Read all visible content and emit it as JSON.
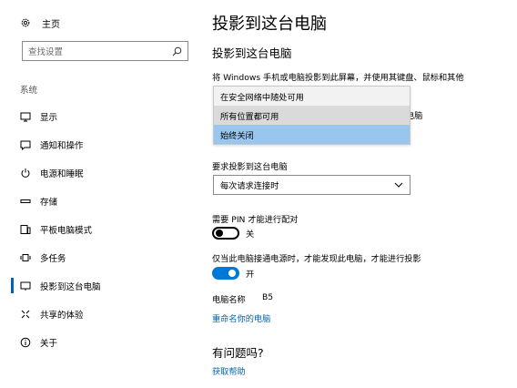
{
  "sidebar": {
    "home_label": "主页",
    "search_placeholder": "查找设置",
    "section_title": "系统",
    "items": [
      {
        "label": "显示",
        "icon": "monitor-icon"
      },
      {
        "label": "通知和操作",
        "icon": "message-icon"
      },
      {
        "label": "电源和睡眠",
        "icon": "power-icon"
      },
      {
        "label": "存储",
        "icon": "storage-icon"
      },
      {
        "label": "平板电脑模式",
        "icon": "tablet-icon"
      },
      {
        "label": "多任务",
        "icon": "multitask-icon"
      },
      {
        "label": "投影到这台电脑",
        "icon": "project-icon",
        "active": true
      },
      {
        "label": "共享的体验",
        "icon": "share-icon"
      },
      {
        "label": "关于",
        "icon": "info-icon"
      }
    ]
  },
  "main": {
    "page_title": "投影到这台电脑",
    "sub_title": "投影到这台电脑",
    "description": "将 Windows 手机或电脑投影到此屏幕，并使用其键盘、鼠标和其他",
    "partial_text": "电脑",
    "dropdown_options": [
      {
        "label": "在安全网络中随处可用",
        "state": "normal"
      },
      {
        "label": "所有位置都可用",
        "state": "hover"
      },
      {
        "label": "始终关闭",
        "state": "selected"
      }
    ],
    "ask_label": "要求投影到这台电脑",
    "ask_value": "每次请求连接时",
    "pin_label": "需要 PIN 才能进行配对",
    "pin_state": "关",
    "power_label": "仅当此电脑接通电源时，才能发现此电脑，才能进行投影",
    "power_state": "开",
    "pc_name_key": "电脑名称",
    "pc_name_value": "B5",
    "rename_link": "重命名你的电脑",
    "question": "有问题吗?",
    "help_link": "获取帮助"
  },
  "colors": {
    "accent": "#0078d7",
    "link": "#0063b1",
    "selected_option": "#99c6ee"
  }
}
